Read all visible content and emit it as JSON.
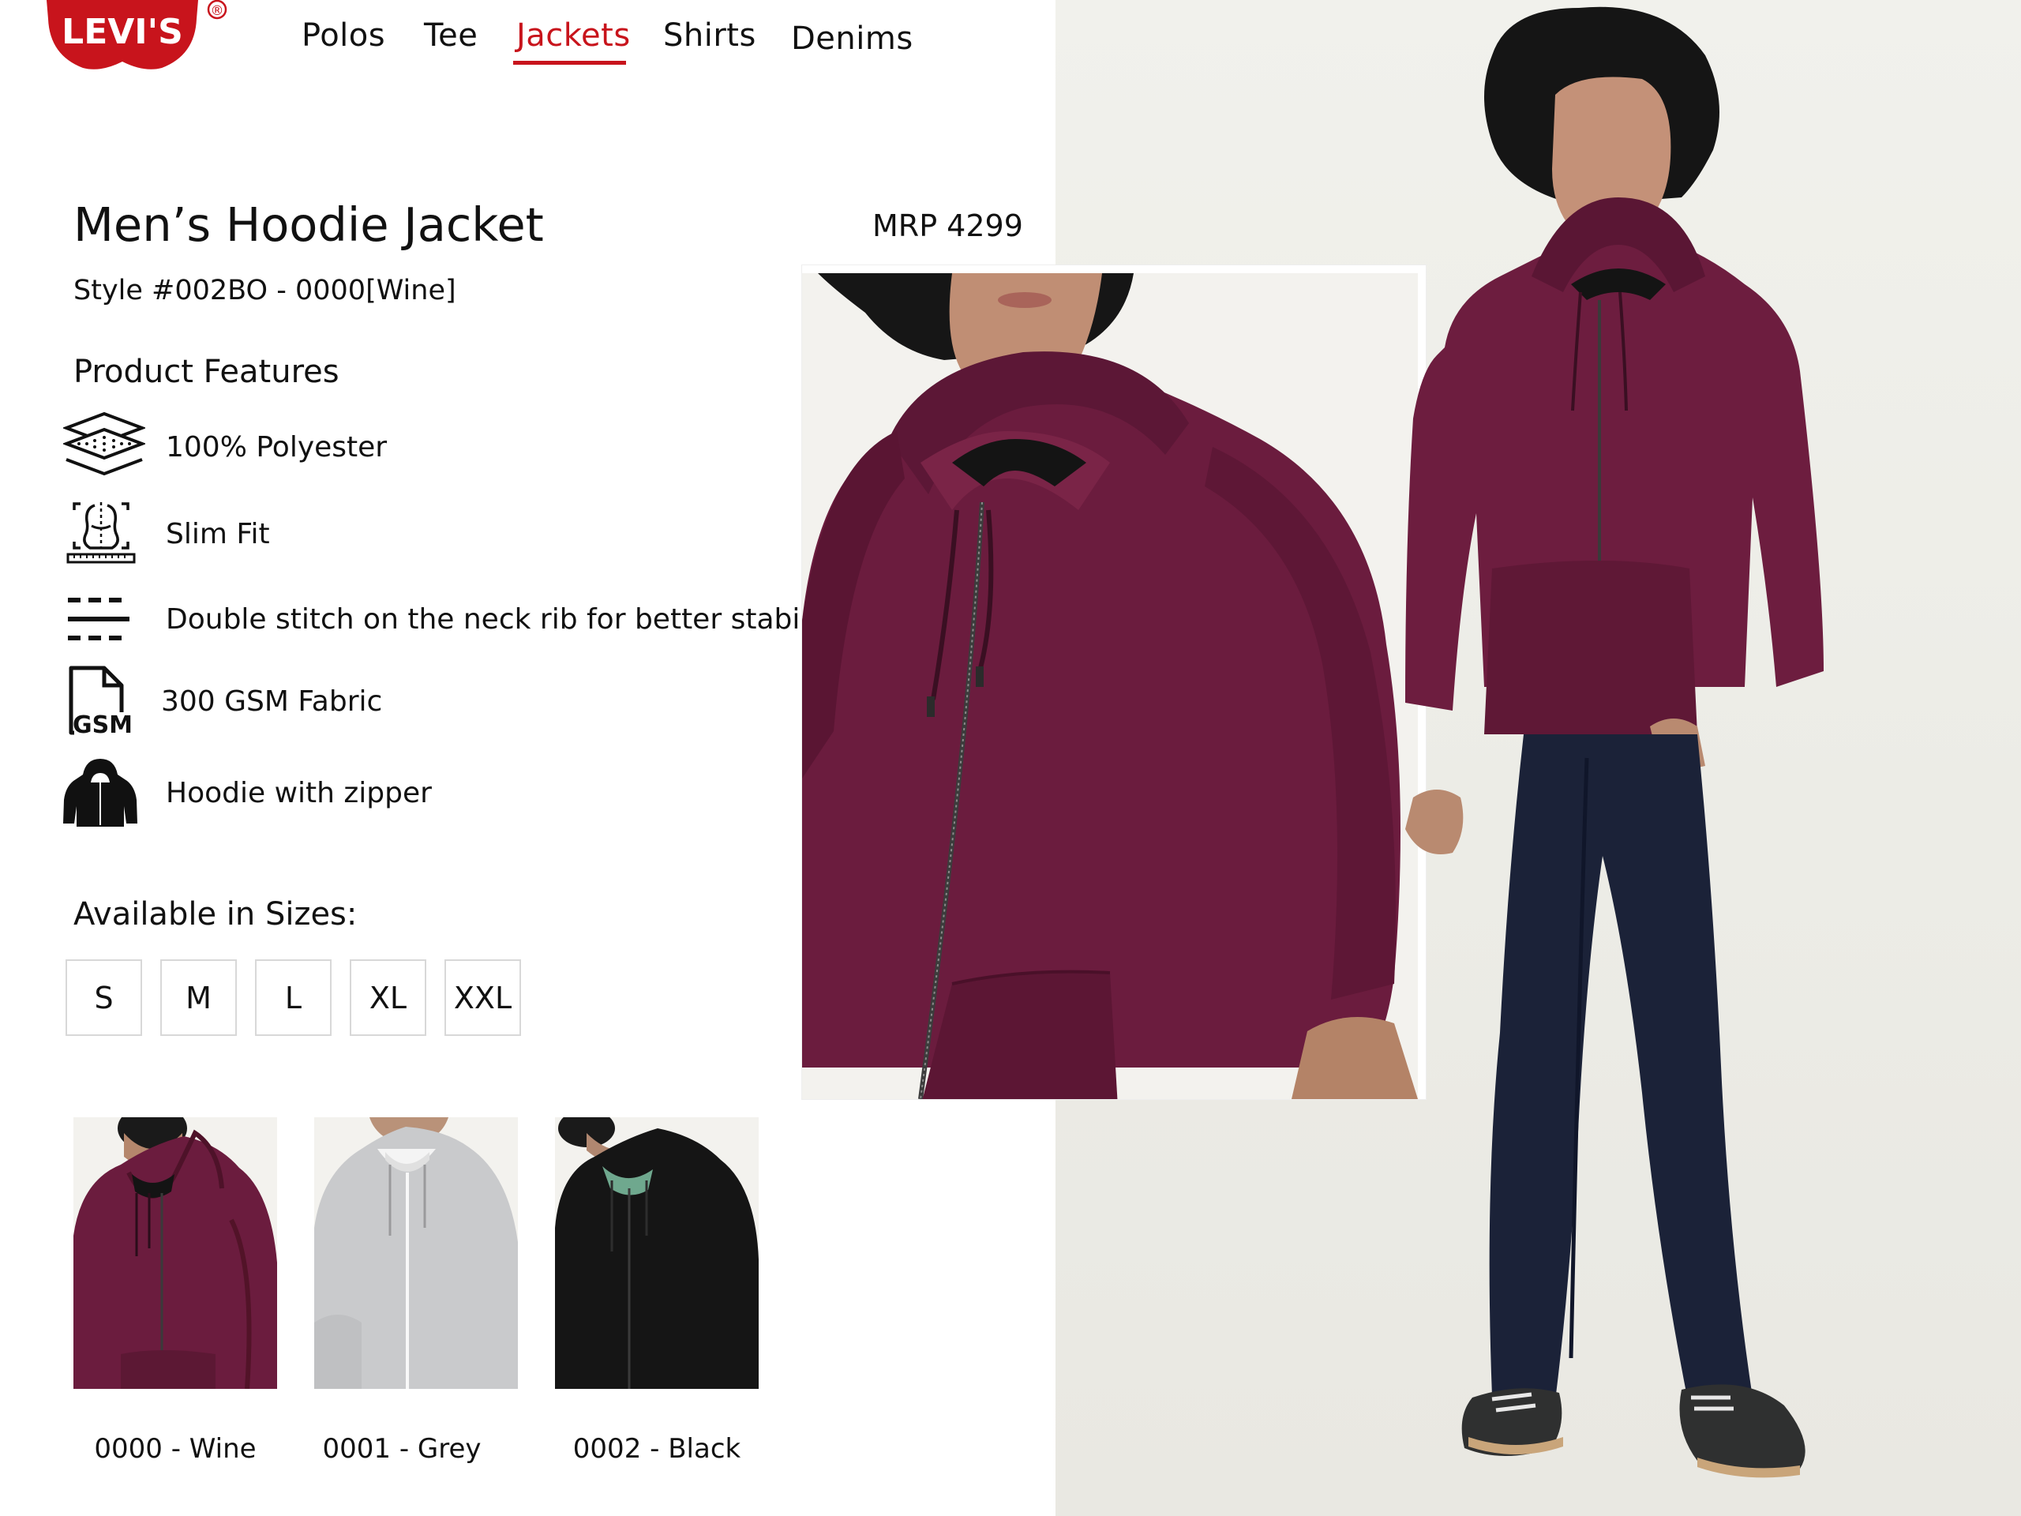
{
  "brand": {
    "logo_text": "LEVI'S",
    "registered_mark": "®",
    "color": "#c8141c"
  },
  "nav": {
    "items": [
      "Polos",
      "Tee",
      "Jackets",
      "Shirts",
      "Denims"
    ],
    "active": "Jackets"
  },
  "product": {
    "title": "Men’s Hoodie Jacket",
    "style": "Style #002BO - 0000[Wine]",
    "price": "MRP 4299"
  },
  "features": {
    "heading": "Product Features",
    "items": [
      {
        "icon": "fabric-layers-icon",
        "text": "100% Polyester"
      },
      {
        "icon": "slim-fit-body-icon",
        "text": "Slim Fit"
      },
      {
        "icon": "double-stitch-icon",
        "text": "Double stitch on the neck rib for better stability"
      },
      {
        "icon": "gsm-file-icon",
        "text": "300 GSM Fabric"
      },
      {
        "icon": "hoodie-icon",
        "text": "Hoodie with zipper"
      }
    ]
  },
  "sizes": {
    "heading": "Available in Sizes:",
    "options": [
      "S",
      "M",
      "L",
      "XL",
      "XXL"
    ]
  },
  "colors": {
    "variants": [
      {
        "label": "0000 - Wine",
        "color": "#6b1c3e"
      },
      {
        "label": "0001 - Grey",
        "color": "#c9cacc"
      },
      {
        "label": "0002 - Black",
        "color": "#151515"
      }
    ]
  }
}
